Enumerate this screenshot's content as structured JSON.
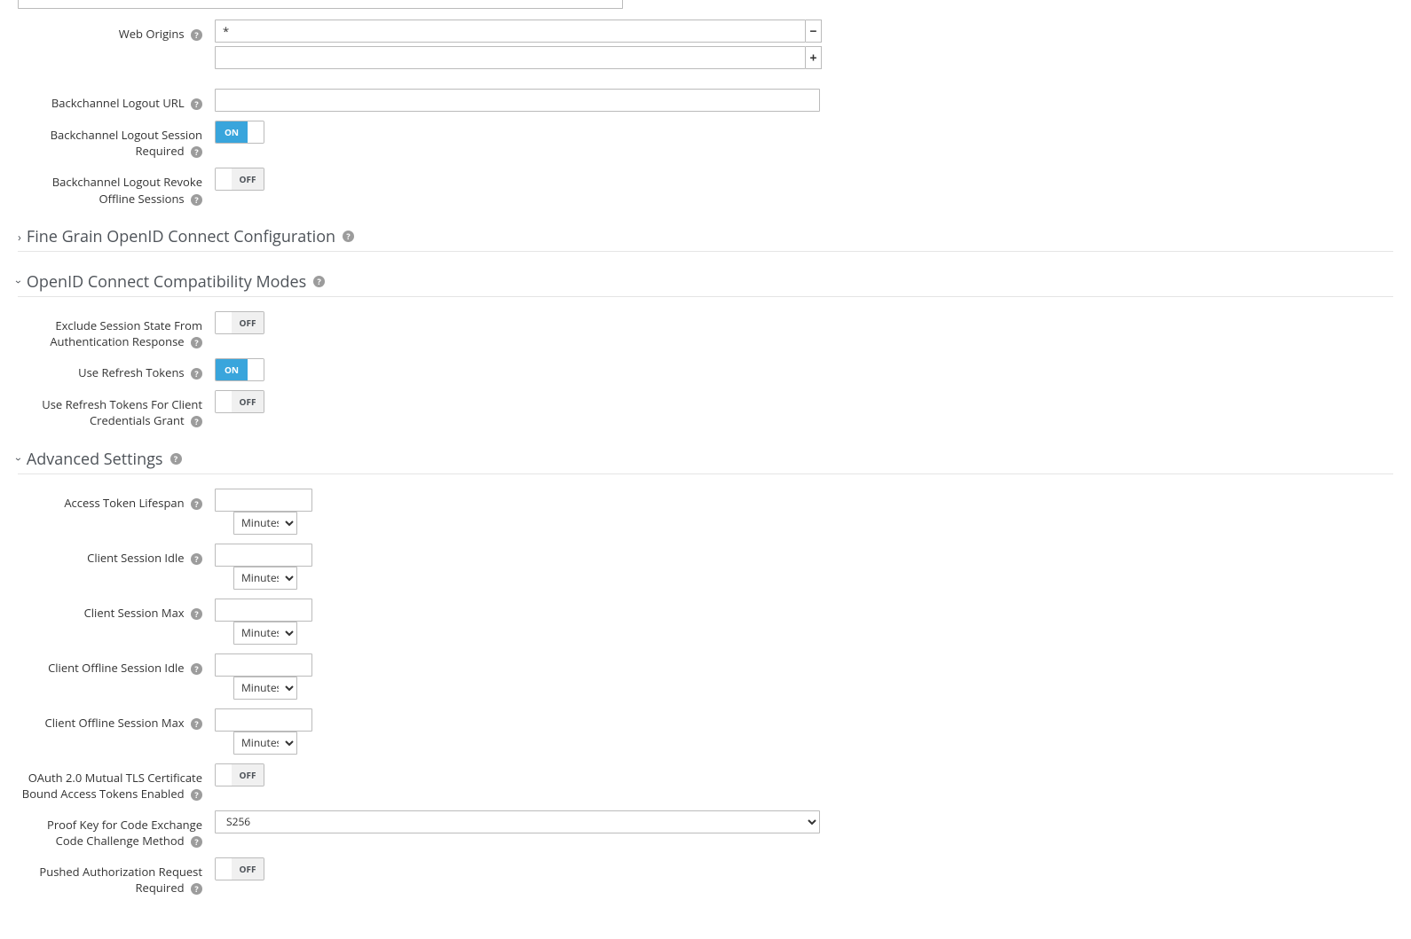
{
  "fields": {
    "webOrigins": {
      "label": "Web Origins",
      "values": [
        "*",
        ""
      ]
    },
    "backchannelLogoutUrl": {
      "label": "Backchannel Logout URL",
      "value": ""
    },
    "backchannelLogoutSessionRequired": {
      "label": "Backchannel Logout Session Required",
      "value": "ON"
    },
    "backchannelLogoutRevokeOffline": {
      "label": "Backchannel Logout Revoke Offline Sessions",
      "value": "OFF"
    }
  },
  "sections": {
    "fineGrain": {
      "title": "Fine Grain OpenID Connect Configuration",
      "expanded": false
    },
    "compatModes": {
      "title": "OpenID Connect Compatibility Modes",
      "expanded": true
    },
    "advanced": {
      "title": "Advanced Settings",
      "expanded": true
    }
  },
  "compat": {
    "excludeSessionState": {
      "label": "Exclude Session State From Authentication Response",
      "value": "OFF"
    },
    "useRefreshTokens": {
      "label": "Use Refresh Tokens",
      "value": "ON"
    },
    "useRefreshTokensCCG": {
      "label": "Use Refresh Tokens For Client Credentials Grant",
      "value": "OFF"
    }
  },
  "advancedFields": {
    "accessTokenLifespan": {
      "label": "Access Token Lifespan",
      "value": "",
      "unit": "Minutes"
    },
    "clientSessionIdle": {
      "label": "Client Session Idle",
      "value": "",
      "unit": "Minutes"
    },
    "clientSessionMax": {
      "label": "Client Session Max",
      "value": "",
      "unit": "Minutes"
    },
    "clientOfflineSessionIdle": {
      "label": "Client Offline Session Idle",
      "value": "",
      "unit": "Minutes"
    },
    "clientOfflineSessionMax": {
      "label": "Client Offline Session Max",
      "value": "",
      "unit": "Minutes"
    },
    "mutualTLS": {
      "label": "OAuth 2.0 Mutual TLS Certificate Bound Access Tokens Enabled",
      "value": "OFF"
    },
    "pkceMethod": {
      "label": "Proof Key for Code Exchange Code Challenge Method",
      "value": "S256"
    },
    "parRequired": {
      "label": "Pushed Authorization Request Required",
      "value": "OFF"
    }
  },
  "toggleLabels": {
    "on": "ON",
    "off": "OFF"
  },
  "unitOptions": [
    "Minutes"
  ],
  "pkceOptions": [
    "S256"
  ]
}
